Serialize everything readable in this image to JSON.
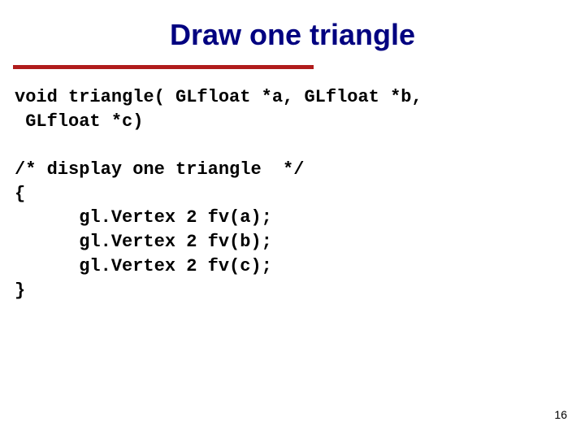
{
  "title": "Draw one triangle",
  "code": "void triangle( GLfloat *a, GLfloat *b,\n GLfloat *c)\n\n/* display one triangle  */\n{\n      gl.Vertex 2 fv(a);\n      gl.Vertex 2 fv(b);\n      gl.Vertex 2 fv(c);\n}",
  "page_number": "16",
  "colors": {
    "title": "#000080",
    "rule": "#b01c1c"
  }
}
